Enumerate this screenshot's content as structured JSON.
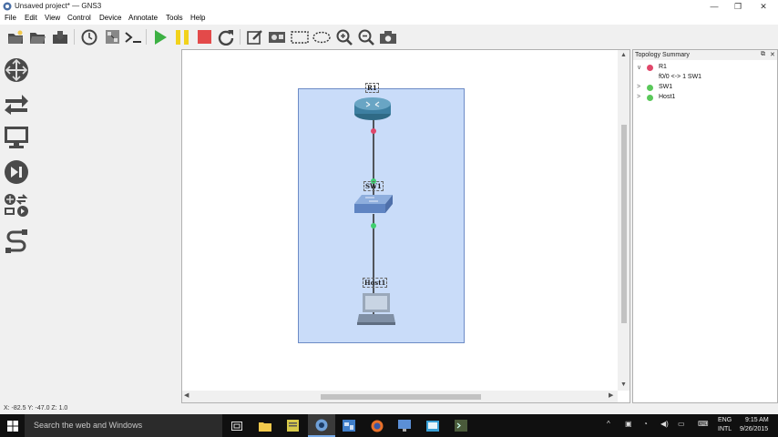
{
  "window": {
    "title": "Unsaved project* — GNS3",
    "controls": {
      "minimize": "—",
      "restore": "❐",
      "close": "✕"
    }
  },
  "menu": [
    "File",
    "Edit",
    "View",
    "Control",
    "Device",
    "Annotate",
    "Tools",
    "Help"
  ],
  "toolbar": [
    "new-project",
    "open-project",
    "save-project",
    "snapshot",
    "show-interface-labels",
    "console-all",
    "start-all",
    "suspend-all",
    "stop-all",
    "reload-all",
    "add-note",
    "insert-picture",
    "draw-rectangle",
    "draw-ellipse",
    "zoom-in",
    "zoom-out",
    "screenshot"
  ],
  "device_dock": [
    "routers",
    "switches",
    "end-devices",
    "security-devices",
    "all-devices",
    "add-link"
  ],
  "topology": {
    "nodes": [
      {
        "name": "R1",
        "type": "router"
      },
      {
        "name": "SW1",
        "type": "switch"
      },
      {
        "name": "Host1",
        "type": "host"
      }
    ],
    "link_status_colors": {
      "stopped": "#e0476a",
      "started": "#3fcf6f"
    }
  },
  "summary": {
    "title": "Topology Summary",
    "items": [
      {
        "label": "R1",
        "status_color": "#e0476a",
        "expanded": true,
        "arrow": "∨",
        "children": [
          "f0/0 <-> 1 SW1"
        ]
      },
      {
        "label": "SW1",
        "status_color": "#5ac85a",
        "expanded": false,
        "arrow": ">"
      },
      {
        "label": "Host1",
        "status_color": "#5ac85a",
        "expanded": false,
        "arrow": ">"
      }
    ]
  },
  "status_bar": {
    "coords": "X: -82.5 Y: -47.0 Z: 1.0"
  },
  "taskbar": {
    "search_placeholder": "Search the web and Windows",
    "language": "ENG",
    "layout": "INTL",
    "time": "9:15 AM",
    "date": "9/26/2015"
  }
}
